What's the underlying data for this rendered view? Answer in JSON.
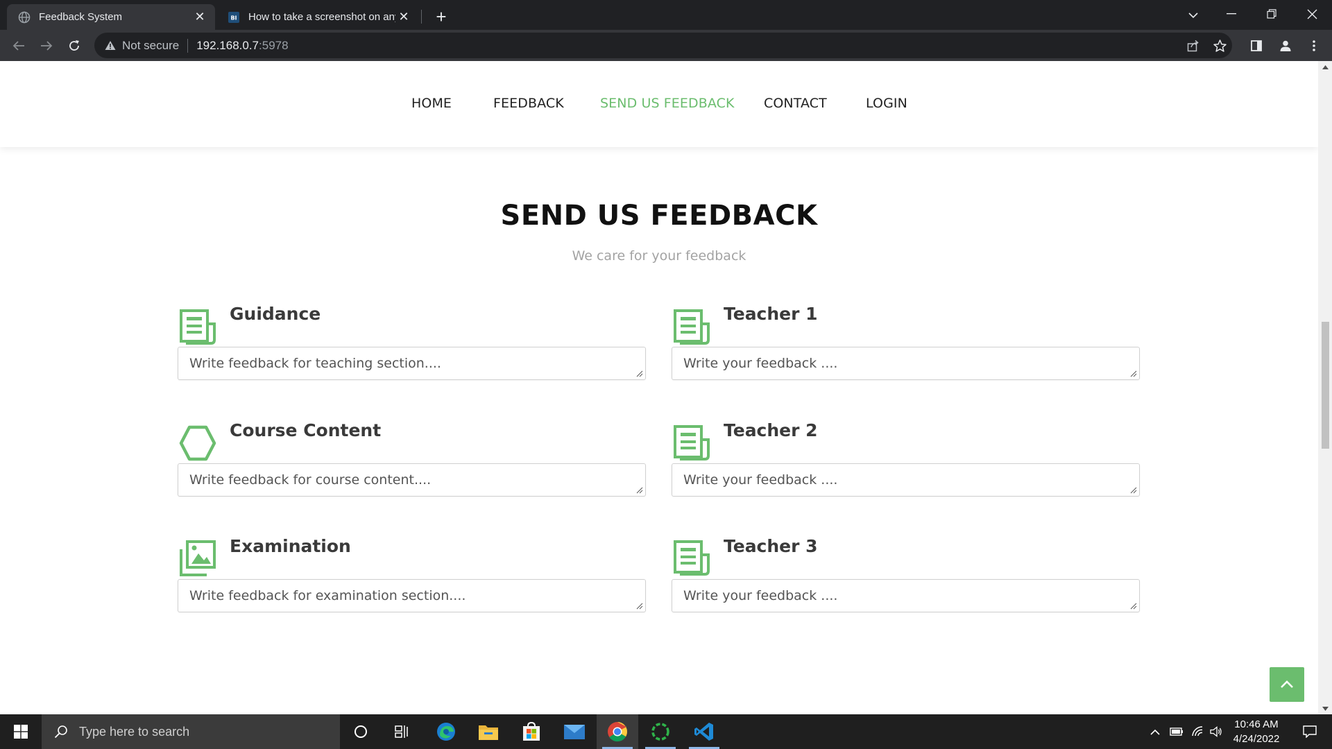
{
  "browser": {
    "tabs": [
      {
        "title": "Feedback System",
        "favicon": "globe-icon",
        "active": true
      },
      {
        "title": "How to take a screenshot on any",
        "favicon": "BI",
        "active": false
      }
    ],
    "address": {
      "security_label": "Not secure",
      "host": "192.168.0.7",
      "port": ":5978"
    }
  },
  "site": {
    "nav": [
      {
        "label": "HOME",
        "active": false
      },
      {
        "label": "FEEDBACK",
        "active": false
      },
      {
        "label": "SEND US FEEDBACK",
        "active": true
      },
      {
        "label": "CONTACT",
        "active": false
      },
      {
        "label": "LOGIN",
        "active": false
      }
    ],
    "section": {
      "title": "SEND US FEEDBACK",
      "subtitle": "We care for your feedback"
    },
    "fields": [
      {
        "label": "Guidance",
        "placeholder": "Write feedback for teaching section....",
        "icon": "newspaper-icon"
      },
      {
        "label": "Teacher 1",
        "placeholder": "Write your feedback ....",
        "icon": "newspaper-icon"
      },
      {
        "label": "Course Content",
        "placeholder": "Write feedback for course content....",
        "icon": "hexagon-icon"
      },
      {
        "label": "Teacher 2",
        "placeholder": "Write your feedback ....",
        "icon": "newspaper-icon"
      },
      {
        "label": "Examination",
        "placeholder": "Write feedback for examination section....",
        "icon": "images-icon"
      },
      {
        "label": "Teacher 3",
        "placeholder": "Write your feedback ....",
        "icon": "newspaper-icon"
      }
    ],
    "accent_color": "#6bbd6e"
  },
  "taskbar": {
    "search_placeholder": "Type here to search",
    "time": "10:46 AM",
    "date": "4/24/2022"
  }
}
